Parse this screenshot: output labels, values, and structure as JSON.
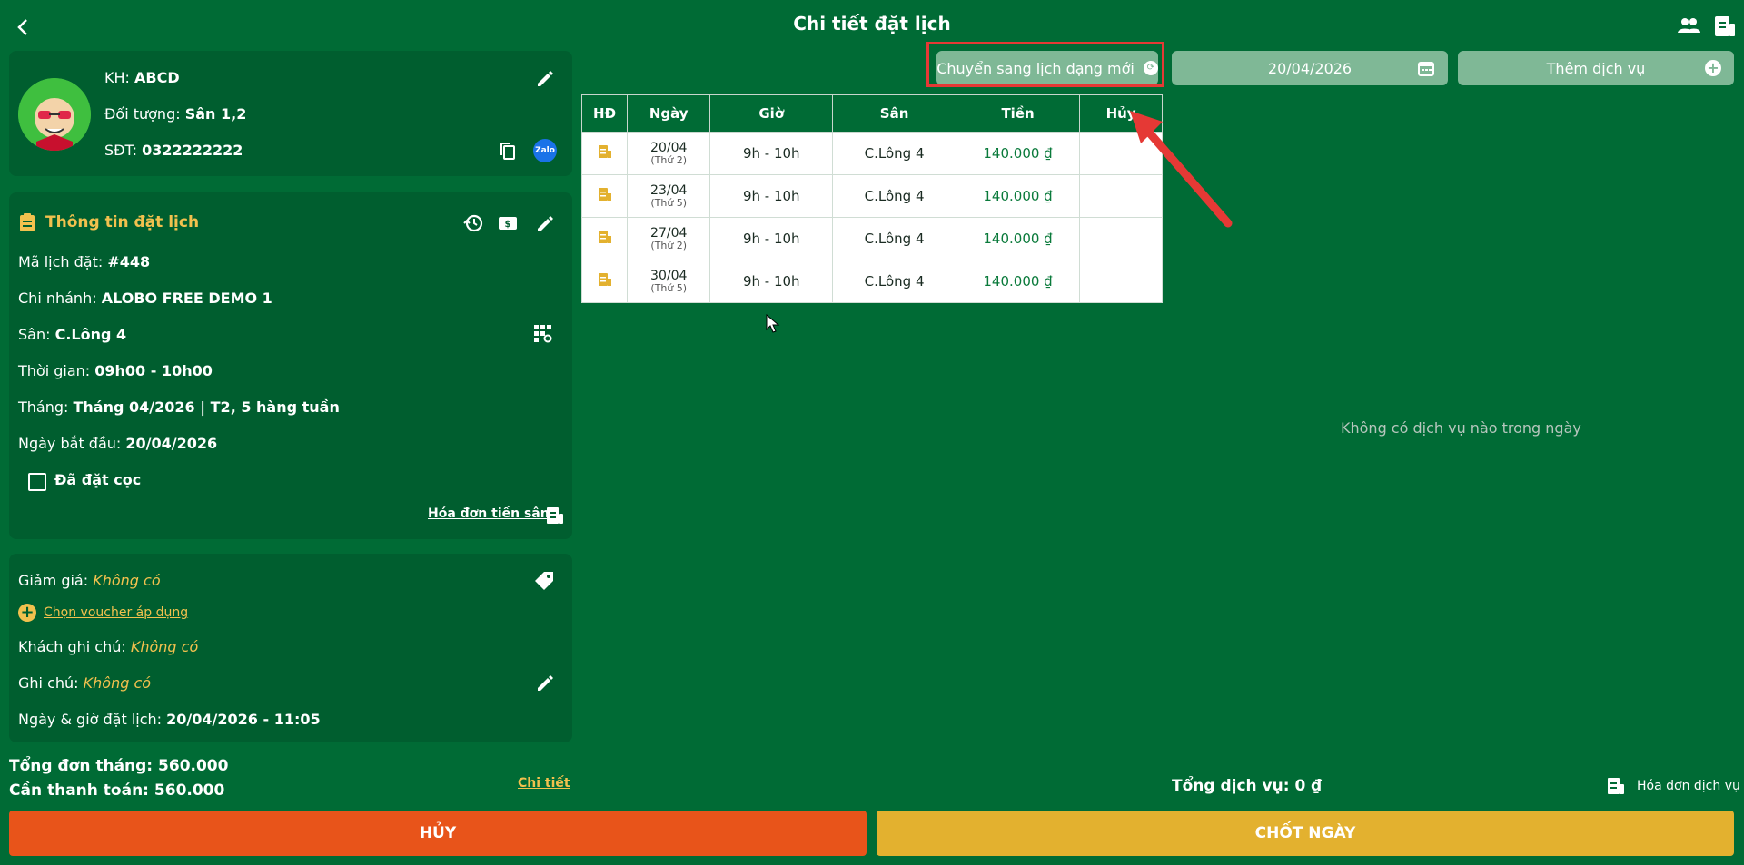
{
  "header": {
    "title": "Chi tiết đặt lịch"
  },
  "customer": {
    "name_label": "KH:",
    "name": "ABCD",
    "target_label": "Đối tượng:",
    "target": "Sân 1,2",
    "phone_label": "SĐT:",
    "phone": "0322222222",
    "zalo": "Zalo"
  },
  "booking": {
    "section_title": "Thông tin đặt lịch",
    "code_label": "Mã lịch đặt:",
    "code": "#448",
    "branch_label": "Chi nhánh:",
    "branch": "ALOBO FREE DEMO 1",
    "court_label": "Sân:",
    "court": "C.Lông 4",
    "time_label": "Thời gian:",
    "time": "09h00 - 10h00",
    "month_label": "Tháng:",
    "month": "Tháng 04/2026 | T2, 5 hàng tuần",
    "start_label": "Ngày bắt đầu:",
    "start": "20/04/2026",
    "deposit_label": "Đã đặt cọc",
    "invoice_link": "Hóa đơn tiền sân"
  },
  "extra": {
    "discount_label": "Giảm giá:",
    "discount": "Không có",
    "voucher_link": "Chọn voucher áp dụng",
    "customer_note_label": "Khách ghi chú:",
    "customer_note": "Không có",
    "note_label": "Ghi chú:",
    "note": "Không có",
    "booked_at_label": "Ngày & giờ đặt lịch:",
    "booked_at": "20/04/2026 - 11:05"
  },
  "totals": {
    "month_total_label": "Tổng đơn tháng:",
    "month_total": "560.000",
    "to_pay_label": "Cần thanh toán:",
    "to_pay": "560.000",
    "detail_link": "Chi tiết",
    "service_total": "Tổng dịch vụ: 0 ₫",
    "service_invoice_link": "Hóa đơn dịch vụ"
  },
  "toolbar": {
    "convert_label": "Chuyển sang lịch dạng mới",
    "date": "20/04/2026",
    "add_service_label": "Thêm dịch vụ"
  },
  "table": {
    "headers": [
      "HĐ",
      "Ngày",
      "Giờ",
      "Sân",
      "Tiền",
      "Hủy"
    ],
    "rows": [
      {
        "date": "20/04",
        "dow": "(Thứ 2)",
        "time": "9h - 10h",
        "court": "C.Lông 4",
        "price": "140.000 ₫"
      },
      {
        "date": "23/04",
        "dow": "(Thứ 5)",
        "time": "9h - 10h",
        "court": "C.Lông 4",
        "price": "140.000 ₫"
      },
      {
        "date": "27/04",
        "dow": "(Thứ 2)",
        "time": "9h - 10h",
        "court": "C.Lông 4",
        "price": "140.000 ₫"
      },
      {
        "date": "30/04",
        "dow": "(Thứ 5)",
        "time": "9h - 10h",
        "court": "C.Lông 4",
        "price": "140.000 ₫"
      }
    ]
  },
  "empty_service": "Không có dịch vụ nào trong ngày",
  "actions": {
    "cancel": "HỦY",
    "close_day": "CHỐT NGÀY"
  },
  "colors": {
    "bg": "#006b35",
    "card": "#005e2f",
    "cancel": "#e8541a",
    "close": "#e3b12f",
    "accent": "#f2c14e"
  }
}
